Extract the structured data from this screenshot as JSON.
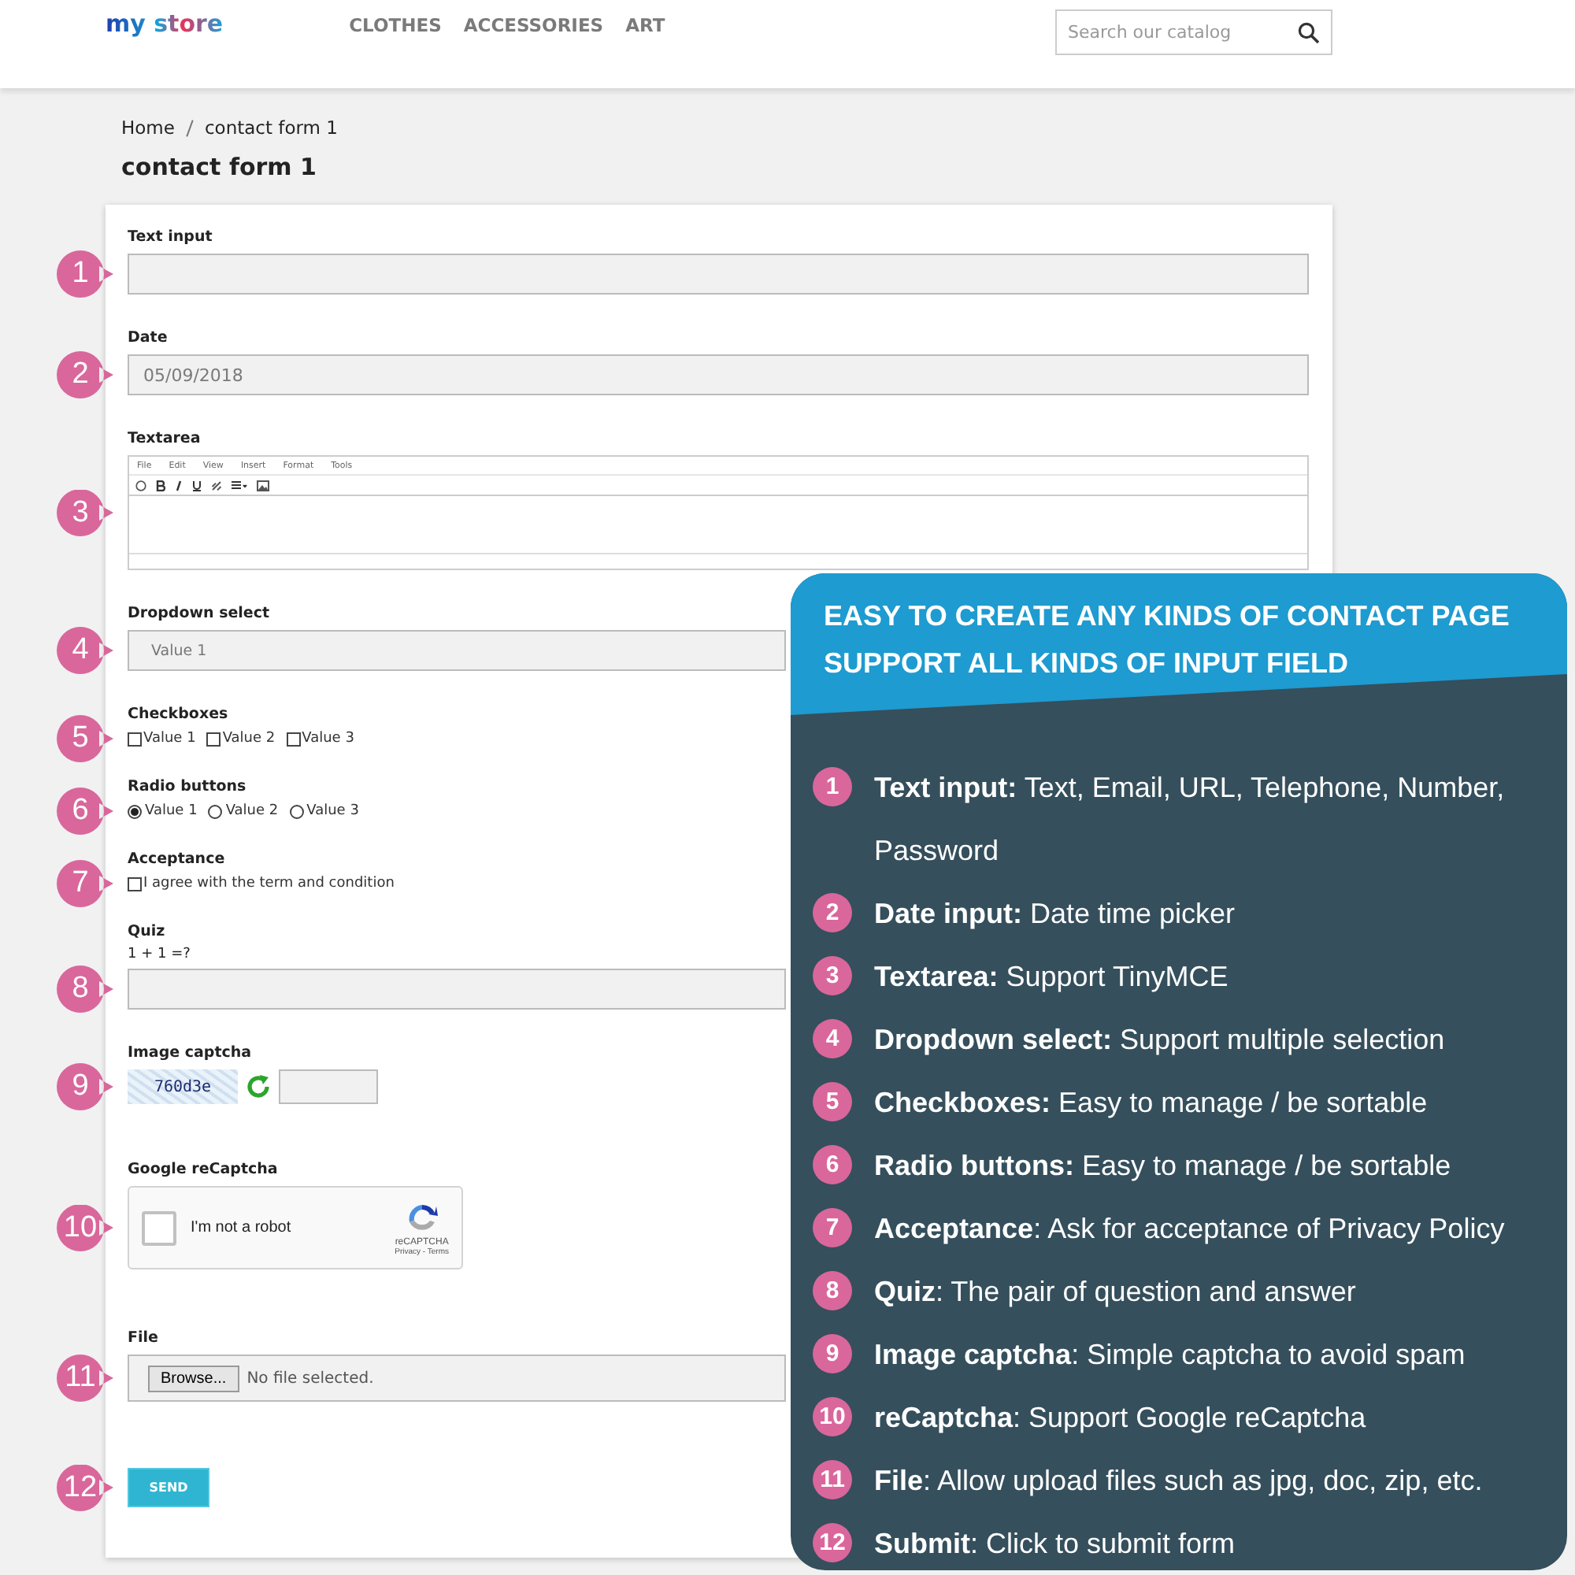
{
  "header": {
    "logo": "my store",
    "nav": [
      "CLOTHES",
      "ACCESSORIES",
      "ART"
    ],
    "search": {
      "placeholder": "Search our catalog"
    }
  },
  "breadcrumb": [
    "Home",
    "contact form 1"
  ],
  "page_title": "contact form 1",
  "form": {
    "fields": [
      {
        "kind": "text",
        "marker": "1",
        "label": "Text input"
      },
      {
        "kind": "text",
        "marker": "2",
        "label": "Date",
        "value": "05/09/2018"
      },
      {
        "kind": "editor",
        "marker": "3",
        "label": "Textarea",
        "menu": [
          "File",
          "Edit",
          "View",
          "Insert",
          "Format",
          "Tools"
        ]
      },
      {
        "kind": "select",
        "marker": "4",
        "label": "Dropdown select",
        "value": "Value 1"
      },
      {
        "kind": "checkboxes",
        "marker": "5",
        "label": "Checkboxes",
        "options": [
          {
            "label": "Value 1",
            "checked": false
          },
          {
            "label": "Value 2",
            "checked": false
          },
          {
            "label": "Value 3",
            "checked": false
          }
        ]
      },
      {
        "kind": "radios",
        "marker": "6",
        "label": "Radio buttons",
        "options": [
          {
            "label": "Value 1",
            "selected": true
          },
          {
            "label": "Value 2",
            "selected": false
          },
          {
            "label": "Value 3",
            "selected": false
          }
        ]
      },
      {
        "kind": "checkboxes",
        "marker": "7",
        "label": "Acceptance",
        "options": [
          {
            "label": "I agree with the term and condition",
            "checked": false
          }
        ]
      },
      {
        "kind": "quiz",
        "marker": "8",
        "label": "Quiz",
        "question": "1 + 1 =?"
      },
      {
        "kind": "captcha",
        "marker": "9",
        "label": "Image captcha",
        "code": "760d3e"
      },
      {
        "kind": "recaptcha",
        "marker": "10",
        "label": "Google reCaptcha",
        "text": "I'm not a robot",
        "checked": false,
        "brand": "reCAPTCHA",
        "links": "Privacy - Terms"
      },
      {
        "kind": "file",
        "marker": "11",
        "label": "File",
        "button": "Browse...",
        "status": "No file selected."
      },
      {
        "kind": "submit",
        "marker": "12",
        "button": "SEND"
      }
    ]
  },
  "panel": {
    "title": [
      "EASY TO CREATE ANY KINDS OF CONTACT PAGE",
      "SUPPORT ALL KINDS OF INPUT FIELD"
    ],
    "features": [
      {
        "number": "1",
        "text": "**Text input:** Text, Email, URL, Telephone, Number, Password"
      },
      {
        "number": "2",
        "text": "**Date input:** Date time picker"
      },
      {
        "number": "3",
        "text": "**Textarea:** Support TinyMCE"
      },
      {
        "number": "4",
        "text": "**Dropdown select:** Support multiple selection"
      },
      {
        "number": "5",
        "text": "**Checkboxes:** Easy to manage / be sortable"
      },
      {
        "number": "6",
        "text": "**Radio buttons:** Easy to manage / be sortable"
      },
      {
        "number": "7",
        "text": "**Acceptance**: Ask for acceptance of Privacy Policy"
      },
      {
        "number": "8",
        "text": "**Quiz**: The pair of question and answer"
      },
      {
        "number": "9",
        "text": "**Image captcha**: Simple captcha to avoid spam"
      },
      {
        "number": "10",
        "text": "**reCaptcha**: Support Google reCaptcha"
      },
      {
        "number": "11",
        "text": "**File**: Allow upload files such as jpg, doc, zip, etc."
      },
      {
        "number": "12",
        "text": "**Submit**: Click to submit form"
      }
    ]
  }
}
